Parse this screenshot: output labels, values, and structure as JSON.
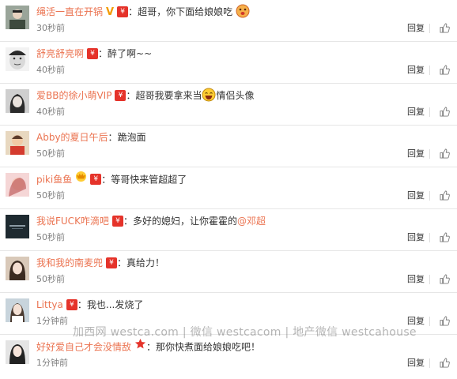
{
  "comments": [
    {
      "user": "绳活一直在开锅",
      "text": "超哥，你下面给娘娘吃",
      "time": "30秒前"
    },
    {
      "user": "舒亮舒亮啊",
      "text": "醉了啊~~",
      "time": "40秒前"
    },
    {
      "user": "爱BB的徐小萌VIP",
      "text_before": "超哥我要拿来当",
      "text_after": "情侣头像",
      "time": "40秒前"
    },
    {
      "user": "Abby的夏日午后",
      "text": "跪泡面",
      "time": "50秒前"
    },
    {
      "user": "piki鱼鱼",
      "text": "等哥快来管超超了",
      "time": "50秒前"
    },
    {
      "user": "我说FUCK咋滴吧",
      "text": "多好的媳妇，让你霍霍的",
      "mention": "@邓超",
      "time": "50秒前"
    },
    {
      "user": "我和我的南麦兜",
      "text": "真给力！",
      "time": "50秒前"
    },
    {
      "user": "Littya",
      "text": "我也...发烧了",
      "time": "1分钟前"
    },
    {
      "user": "好好爱自己才会没情敌",
      "text": "那你快煮面给娘娘吃吧！",
      "time": "1分钟前"
    }
  ],
  "reply_label": "回复",
  "colon": "：",
  "watermark": "加西网 westca.com | 微信 westcacom | 地产微信 westcahouse",
  "colors": {
    "username": "#eb7350",
    "badge": "#e5332a",
    "time": "#808080"
  },
  "icons": [
    "thumb-up-icon",
    "red-envelope-badge-icon",
    "verified-v-icon",
    "laughing-emoji-icon",
    "star-badge-icon",
    "wow-emoji-icon"
  ]
}
